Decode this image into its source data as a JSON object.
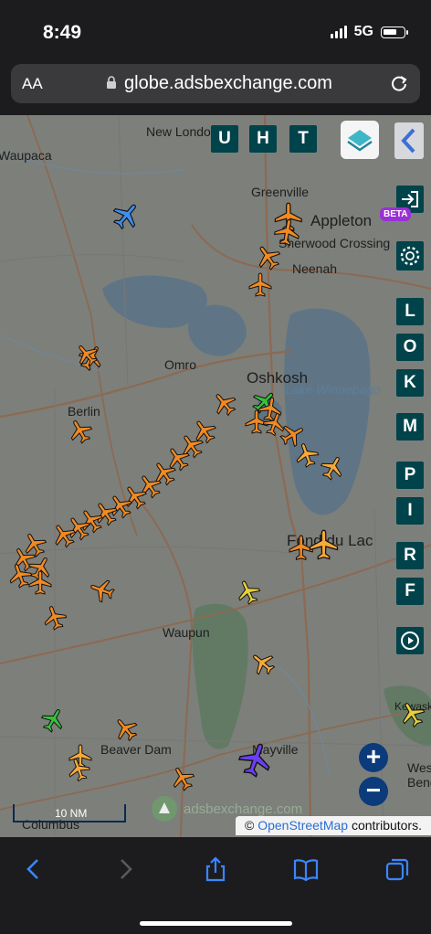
{
  "status": {
    "time": "8:49",
    "network": "5G"
  },
  "browser": {
    "text_size_label": "AA",
    "url": "globe.adsbexchange.com"
  },
  "map": {
    "towns": [
      "New London",
      "Waupaca",
      "Greenville",
      "Appleton",
      "Sherwood Crossing",
      "Neenah",
      "Omro",
      "Oshkosh",
      "Lake Winnebago",
      "Berlin",
      "Fond du Lac",
      "Waupun",
      "Mayville",
      "Beaver Dam",
      "Columbus",
      "Kewaskum",
      "West Bend"
    ],
    "scale_label": "10 NM",
    "watermark": "adsbexchange.com",
    "attribution_prefix": "©",
    "attribution_link": "OpenStreetMap",
    "attribution_suffix": "contributors."
  },
  "controls": {
    "top_buttons": [
      "U",
      "H",
      "T"
    ],
    "beta_badge": "BETA",
    "side_buttons": [
      "L",
      "O",
      "K",
      "M",
      "P",
      "I",
      "R",
      "F"
    ],
    "zoom_in": "+",
    "zoom_out": "−"
  },
  "colors": {
    "plane_orange": "#f08a24",
    "plane_light_orange": "#f7a93a",
    "plane_yellow": "#e6d13a",
    "plane_blue": "#3f8ef0",
    "plane_green": "#36c23c",
    "plane_purple": "#6b3ff0",
    "button_teal": "#00434a"
  }
}
